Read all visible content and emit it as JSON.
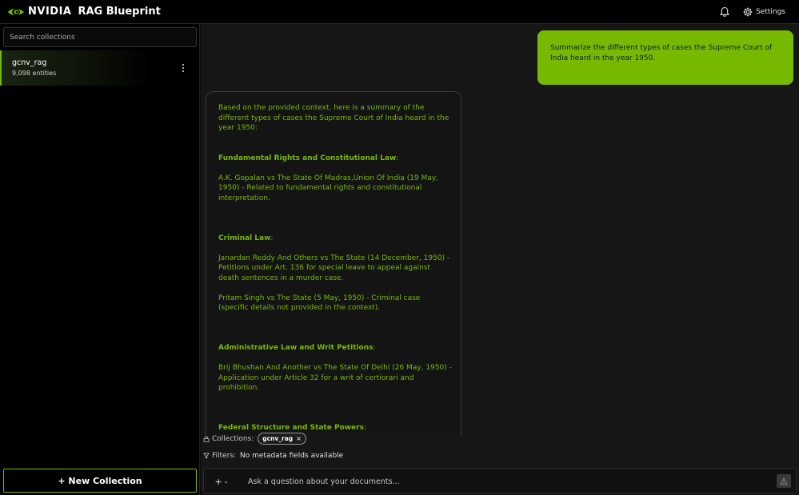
{
  "header": {
    "brand": "NVIDIA",
    "title": "RAG Blueprint",
    "settings_label": "Settings"
  },
  "sidebar": {
    "search_placeholder": "Search collections",
    "collections": [
      {
        "name": "gcnv_rag",
        "count": "9,098 entities"
      }
    ],
    "new_collection_label": "+ New Collection"
  },
  "chat": {
    "user_message": "Summarize the different types of cases the Supreme Court of India heard in the year 1950.",
    "response": {
      "intro": "Based on the provided context, here is a summary of the different types of cases the Supreme Court of India heard in the year 1950:",
      "sections": [
        {
          "heading": "Fundamental Rights and Constitutional Law",
          "items": [
            "A.K. Gopalan vs The State Of Madras,Union Of India (19 May, 1950) - Related to fundamental rights and constitutional interpretation."
          ]
        },
        {
          "heading": "Criminal Law",
          "items": [
            "Janardan Reddy And Others vs The State (14 December, 1950) - Petitions under Art. 136 for special leave to appeal against death sentences in a murder case.",
            "Pritam Singh vs The State (5 May, 1950) - Criminal case (specific details not provided in the context)."
          ]
        },
        {
          "heading": "Administrative Law and Writ Petitions",
          "items": [
            "Brij Bhushan And Another vs The State Of Delhi (26 May, 1950) - Application under Article 32 for a writ of certiorari and prohibition."
          ]
        },
        {
          "heading": "Federal Structure and State Powers",
          "items": []
        }
      ]
    }
  },
  "context_bar": {
    "collections_label": "Collections:",
    "collection_chip": "gcnv_rag",
    "chip_close": "×",
    "filters_label": "Filters:",
    "filters_value": "No metadata fields available"
  },
  "composer": {
    "plus_label": "+",
    "placeholder": "Ask a question about your documents..."
  },
  "colors": {
    "accent": "#76b900",
    "background": "#161616",
    "sidebar": "#000000"
  },
  "icons": {
    "bell": "bell-icon",
    "gear": "gear-icon",
    "lock": "lock-icon",
    "filter": "filter-icon",
    "send": "send-icon",
    "kebab": "more-vertical-icon"
  }
}
